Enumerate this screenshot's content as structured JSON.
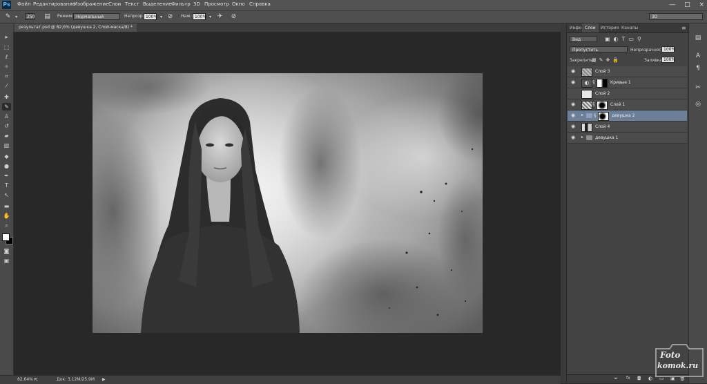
{
  "app": {
    "logo": "Ps"
  },
  "menu": [
    "Файл",
    "Редактирование",
    "Изображение",
    "Слои",
    "Текст",
    "Выделение",
    "Фильтр",
    "3D",
    "Просмотр",
    "Окно",
    "Справка"
  ],
  "window_controls": {
    "minimize": "—",
    "maximize": "□",
    "close": "×"
  },
  "options_bar": {
    "brush_size": "250",
    "mode_label": "Режим:",
    "mode_value": "Нормальный",
    "opacity_label": "Непрозр.:",
    "opacity_value": "100%",
    "flow_label": "Наж.:",
    "flow_value": "100%",
    "workspace": "3D"
  },
  "document": {
    "tab_title": "результат.psd @ 82,6% (девушка 2, Слой-маска/8) *"
  },
  "status": {
    "zoom": "82,64%",
    "doc_info": "Док: 3,12M/25,9M"
  },
  "panels": {
    "tabs": [
      "Инфо",
      "Слои",
      "История",
      "Каналы"
    ],
    "active_tab": "Слои",
    "filter_kind": "Вид",
    "blend_mode": "Пропустить",
    "opacity_label": "Непрозрачность:",
    "opacity_value": "100%",
    "lock_label": "Закрепить:",
    "fill_label": "Заливка:",
    "fill_value": "100%",
    "layers": [
      {
        "name": "Слой 3",
        "type": "layer",
        "selected": false
      },
      {
        "name": "Кривые 1",
        "type": "adjustment",
        "selected": false
      },
      {
        "name": "Слой 2",
        "type": "layer",
        "selected": false
      },
      {
        "name": "Слой 1",
        "type": "masked",
        "selected": false
      },
      {
        "name": "девушка 2",
        "type": "group",
        "selected": true
      },
      {
        "name": "Слой 4",
        "type": "layer",
        "selected": false
      },
      {
        "name": "девушка 1",
        "type": "group",
        "selected": false
      }
    ],
    "bottom_icons": [
      "∞",
      "fx",
      "◘",
      "◐",
      "▭",
      "▣",
      "🗑"
    ]
  },
  "watermark": {
    "line1": "Foto",
    "line2": "komok.ru"
  },
  "icons": {
    "tools": [
      "move-icon",
      "marquee-icon",
      "lasso-icon",
      "quick-select-icon",
      "crop-icon",
      "eyedropper-icon",
      "healing-icon",
      "brush-icon",
      "stamp-icon",
      "history-brush-icon",
      "eraser-icon",
      "gradient-icon",
      "blur-icon",
      "dodge-icon",
      "pen-icon",
      "type-icon",
      "path-select-icon",
      "shape-icon",
      "hand-icon",
      "zoom-icon"
    ]
  }
}
